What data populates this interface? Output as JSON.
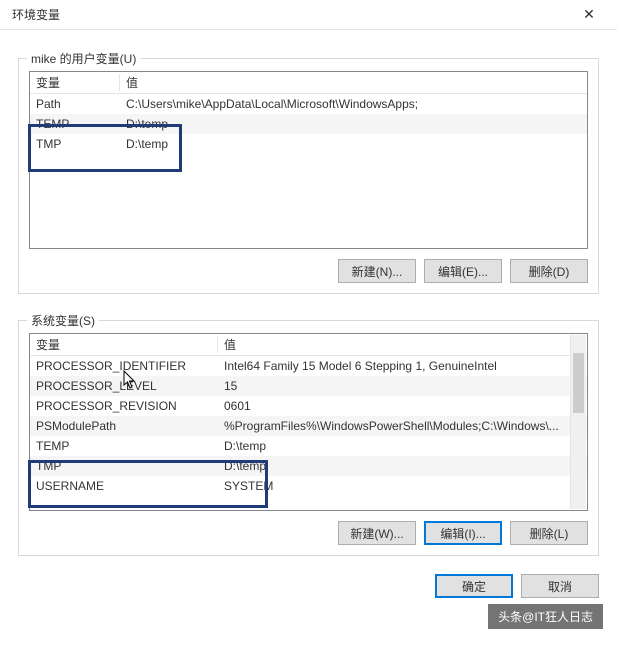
{
  "window": {
    "title": "环境变量",
    "close_label": "✕"
  },
  "user_group": {
    "legend": "mike 的用户变量(U)",
    "header_name": "变量",
    "header_value": "值",
    "rows": [
      {
        "name": "Path",
        "value": "C:\\Users\\mike\\AppData\\Local\\Microsoft\\WindowsApps;"
      },
      {
        "name": "TEMP",
        "value": "D:\\temp"
      },
      {
        "name": "TMP",
        "value": "D:\\temp"
      }
    ],
    "btn_new": "新建(N)...",
    "btn_edit": "编辑(E)...",
    "btn_delete": "删除(D)"
  },
  "sys_group": {
    "legend": "系统变量(S)",
    "header_name": "变量",
    "header_value": "值",
    "rows": [
      {
        "name": "PROCESSOR_IDENTIFIER",
        "value": "Intel64 Family 15 Model 6 Stepping 1, GenuineIntel"
      },
      {
        "name": "PROCESSOR_LEVEL",
        "value": "15"
      },
      {
        "name": "PROCESSOR_REVISION",
        "value": "0601"
      },
      {
        "name": "PSModulePath",
        "value": "%ProgramFiles%\\WindowsPowerShell\\Modules;C:\\Windows\\..."
      },
      {
        "name": "TEMP",
        "value": "D:\\temp"
      },
      {
        "name": "TMP",
        "value": "D:\\temp"
      },
      {
        "name": "USERNAME",
        "value": "SYSTEM"
      }
    ],
    "btn_new": "新建(W)...",
    "btn_edit": "编辑(I)...",
    "btn_delete": "删除(L)"
  },
  "footer": {
    "ok": "确定",
    "cancel": "取消"
  },
  "watermark": "头条@IT狂人日志"
}
